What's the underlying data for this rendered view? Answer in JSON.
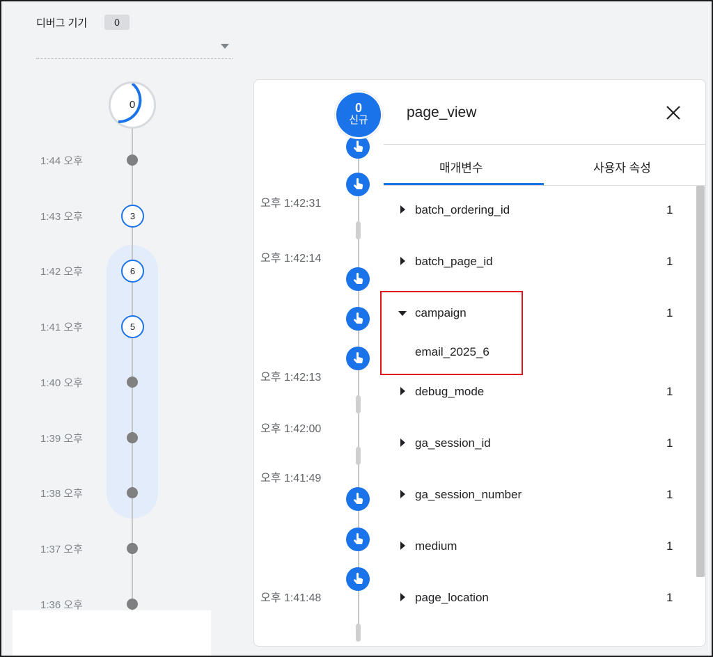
{
  "header": {
    "device_label": "디버그 기기",
    "device_count": "0"
  },
  "minute_timeline": {
    "top_counter": "0",
    "minutes": [
      {
        "label": "1:44 오후",
        "count": null
      },
      {
        "label": "1:43 오후",
        "count": "3"
      },
      {
        "label": "1:42 오후",
        "count": "6"
      },
      {
        "label": "1:41 오후",
        "count": "5"
      },
      {
        "label": "1:40 오후",
        "count": null
      },
      {
        "label": "1:39 오후",
        "count": null
      },
      {
        "label": "1:38 오후",
        "count": null
      },
      {
        "label": "1:37 오후",
        "count": null
      },
      {
        "label": "1:36 오후",
        "count": null
      }
    ]
  },
  "seconds_timeline": {
    "new_users": {
      "count": "0",
      "label": "신규"
    },
    "times": [
      "오후 1:42:31",
      "오후 1:42:14",
      "오후 1:42:13",
      "오후 1:42:00",
      "오후 1:41:49",
      "오후 1:41:48"
    ],
    "event_icon": "touch-pointer-icon"
  },
  "event_panel": {
    "title": "page_view",
    "close_icon": "close-icon",
    "tabs": [
      "매개변수",
      "사용자 속성"
    ],
    "active_tab": 0,
    "parameters": [
      {
        "name": "batch_ordering_id",
        "count": "1",
        "expanded": false
      },
      {
        "name": "batch_page_id",
        "count": "1",
        "expanded": false
      },
      {
        "name": "campaign",
        "count": "1",
        "expanded": true,
        "value": "email_2025_6"
      },
      {
        "name": "debug_mode",
        "count": "1",
        "expanded": false
      },
      {
        "name": "ga_session_id",
        "count": "1",
        "expanded": false
      },
      {
        "name": "ga_session_number",
        "count": "1",
        "expanded": false
      },
      {
        "name": "medium",
        "count": "1",
        "expanded": false
      },
      {
        "name": "page_location",
        "count": "1",
        "expanded": false
      }
    ]
  },
  "colors": {
    "accent": "#1a73e8",
    "highlight_box": "#e0121b",
    "timeline_dot": "#808080",
    "range_highlight": "#e3ecfb"
  }
}
